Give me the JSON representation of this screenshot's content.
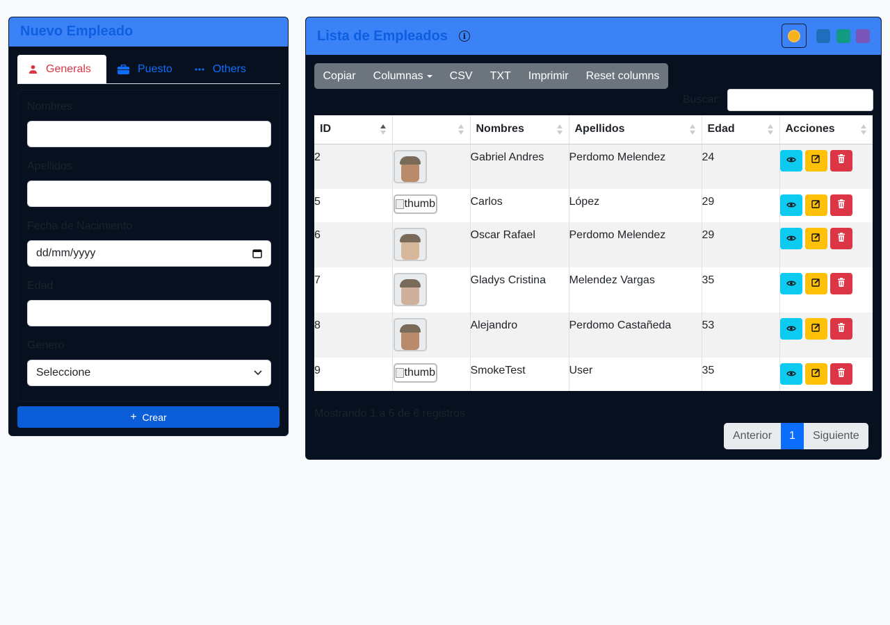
{
  "left_card": {
    "title": "Nuevo Empleado",
    "tabs": [
      {
        "label": "Generals",
        "icon": "user-icon",
        "active": true
      },
      {
        "label": "Puesto",
        "icon": "briefcase-icon"
      },
      {
        "label": "Others",
        "icon": "dots-icon"
      }
    ],
    "fields": {
      "nombres_label": "Nombres",
      "apellidos_label": "Apellidos",
      "fecha_label": "Fecha de Nacimiento",
      "fecha_placeholder": "dd/mm/yyyy",
      "edad_label": "Edad",
      "genero_label": "Genero",
      "genero_value": "Seleccione"
    },
    "create_button": "Crear"
  },
  "right_card": {
    "title": "Lista de Empleados",
    "swatches": [
      "#1f6fbf",
      "#129a84",
      "#7a56b8"
    ],
    "toolbar": [
      "Copiar",
      "Columnas",
      "CSV",
      "TXT",
      "Imprimir",
      "Reset columns"
    ],
    "search_label": "Buscar:",
    "columns": [
      "ID",
      "",
      "Nombres",
      "Apellidos",
      "Edad",
      "Acciones"
    ],
    "rows": [
      {
        "id": "2",
        "photo": "photo",
        "nombres": "Gabriel Andres",
        "apellidos": "Perdomo Melendez",
        "edad": "24"
      },
      {
        "id": "5",
        "photo": "thumb",
        "nombres": "Carlos",
        "apellidos": "López",
        "edad": "29"
      },
      {
        "id": "6",
        "photo": "photo",
        "nombres": "Oscar Rafael",
        "apellidos": "Perdomo Melendez",
        "edad": "29"
      },
      {
        "id": "7",
        "photo": "photo",
        "nombres": "Gladys Cristina",
        "apellidos": "Melendez Vargas",
        "edad": "35"
      },
      {
        "id": "8",
        "photo": "photo",
        "nombres": "Alejandro",
        "apellidos": "Perdomo Castañeda",
        "edad": "53"
      },
      {
        "id": "9",
        "photo": "thumb",
        "nombres": "SmokeTest",
        "apellidos": "User",
        "edad": "35"
      }
    ],
    "info": "Mostrando 1 a 6 de 6 registros",
    "pagination": {
      "prev": "Anterior",
      "current": "1",
      "next": "Siguiente"
    }
  }
}
